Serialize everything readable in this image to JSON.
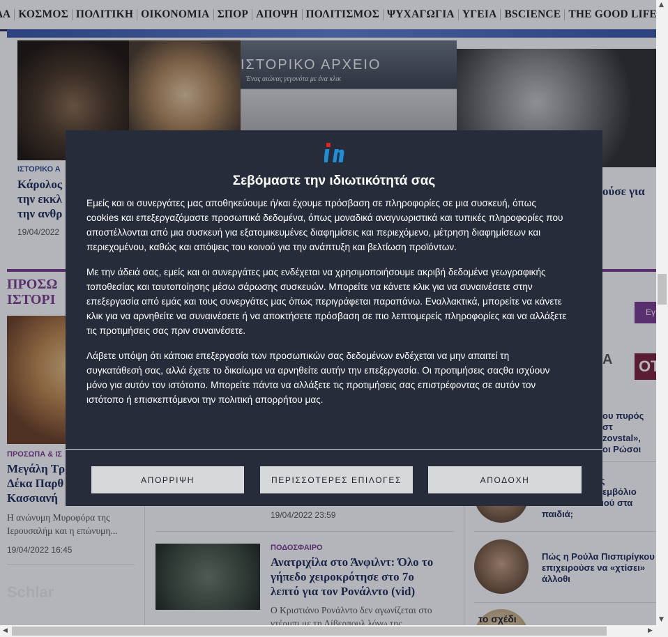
{
  "nav": {
    "items": [
      "ΔΑ",
      "ΚΟΣΜΟΣ",
      "ΠΟΛΙΤΙΚΗ",
      "ΟΙΚΟΝΟΜΙΑ",
      "ΣΠΟΡ",
      "ΑΠΟΨΗ",
      "ΠΟΛΙΤΙΣΜΟΣ",
      "ΨΥΧΑΓΩΓΙΑ",
      "ΥΓΕΙΑ",
      "BSCIENCE",
      "THE GOOD LIFE",
      "T"
    ]
  },
  "top_story": {
    "archive_title": "ΙΣΤΟΡΙΚΟ ΑΡΧΕΙΟ",
    "archive_subtitle": "Ένας αιώνας γεγονότα με ένα κλικ",
    "category": "ΙΣΤΟΡΙΚΟ Α",
    "headline_l1": "Κάρολος",
    "headline_l2": "την εκκλ",
    "headline_l3": "την ανθρ",
    "date": "19/04/2022",
    "right_headline": "ούσε για"
  },
  "section": {
    "title_l1": "ΠΡΟΣΩ",
    "title_l2": "ΙΣΤΟΡΙ",
    "search_btn": "Εγ"
  },
  "left_story": {
    "category": "ΠΡΟΣΩΠΑ & ΙΣ",
    "headline_l1": "Μεγάλη Τρ",
    "headline_l2": "Δέκα Παρθ",
    "headline_l3": "Κασσιανή",
    "summary_l1": "Η ανώνυμη Μυροφόρα της",
    "summary_l2": "Ιερουσαλήμ και η επώνυμη...",
    "date": "19/04/2022 16:45",
    "img_text": "Schlar"
  },
  "mid_story": {
    "date": "19/04/2022 23:59",
    "category": "ΠΟΔΟΣΦΑΙΡΟ",
    "headline_l1": "Ανατριχίλα στο Άνφιλντ: Όλο το",
    "headline_l2": "γήπεδο χειροκρότησε στο 7ο",
    "headline_l3": "λεπτό για τον Ρονάλντο (vid)",
    "summary_l1": "Ο Κριστιάνο Ρονάλντο δεν αγωνίζεται στο",
    "summary_l2": "ντέρμπι με τη Λίβερπουλ λόγω της..."
  },
  "sidebar": {
    "tab1": "Α",
    "tab2": "ΟΤ",
    "item1_l1": "ου πυρός στ",
    "item1_l2": "zovstal»,",
    "item1_l3": "οι Ρώσοι",
    "item2_l1": "της",
    "item2_l2": "το εμβόλιο",
    "item2_l3": "ναιού στα",
    "item2_l4": "παιδιά;",
    "item3_l1": "Πώς η Ρούλα Πισπιρίγκου",
    "item3_l2": "επιχειρούσε να «χτίσει»",
    "item3_l3": "άλλοθι",
    "item4_text": "το σχέδι"
  },
  "consent": {
    "logo": "in",
    "title": "Σεβόμαστε την ιδιωτικότητά σας",
    "p1_lines": [
      "Εμείς και οι συνεργάτες μας αποθηκεύουμε ή/και έχουμε πρόσβαση σε πληροφορίες σε μια συσκευή, όπως",
      "cookies και επεξεργαζόμαστε προσωπικά δεδομένα, όπως μοναδικά αναγνωριστικά και τυπικές πληροφορίες που",
      "αποστέλλονται από μια συσκευή για εξατομικευμένες διαφημίσεις και περιεχόμενο, μέτρηση διαφημίσεων και",
      "περιεχομένου, καθώς και απόψεις του κοινού για την ανάπτυξη και βελτίωση προϊόντων."
    ],
    "p2_lines": [
      "Με την άδειά σας, εμείς και οι συνεργάτες μας ενδέχεται να χρησιμοποιήσουμε ακριβή δεδομένα γεωγραφικής",
      "τοποθεσίας και ταυτοποίησης μέσω σάρωσης συσκευών. Μπορείτε να κάνετε κλικ για να συναινέσετε στην",
      "επεξεργασία από εμάς και τους συνεργάτες μας όπως περιγράφεται παραπάνω. Εναλλακτικά, μπορείτε να κάνετε",
      "κλικ για να αρνηθείτε να συναινέσετε ή να αποκτήσετε πρόσβαση σε πιο λεπτομερείς πληροφορίες και να αλλάξετε",
      "τις προτιμήσεις σας πριν συναινέσετε."
    ],
    "p3_lines": [
      "Λάβετε υπόψη ότι κάποια επεξεργασία των προσωπικών σας δεδομένων ενδέχεται να μην απαιτεί τη",
      "συγκατάθεσή σας, αλλά έχετε το δικαίωμα να αρνηθείτε αυτήν την επεξεργασία. Οι προτιμήσεις σαςθα ισχύουν",
      "μόνο για αυτόν τον ιστότοπο. Μπορείτε πάντα να αλλάξετε τις προτιμήσεις σας επιστρέφοντας σε αυτόν τον",
      "ιστότοπο ή επισκεπτόμενοι την πολιτική απορρήτου μας."
    ],
    "btn_reject": "ΑΠΟΡΡΙΨΗ",
    "btn_more": "ΠΕΡΙΣΣΟΤΕΡΕΣ ΕΠΙΛΟΓΕΣ",
    "btn_accept": "ΑΠΟΔΟΧΗ"
  },
  "colors": {
    "dialog_bg": "#262c3a",
    "button_bg": "#d7d8da",
    "section_accent": "#7d3a8f",
    "logo_red": "#e2231a",
    "logo_blue": "#1e8fd6"
  }
}
